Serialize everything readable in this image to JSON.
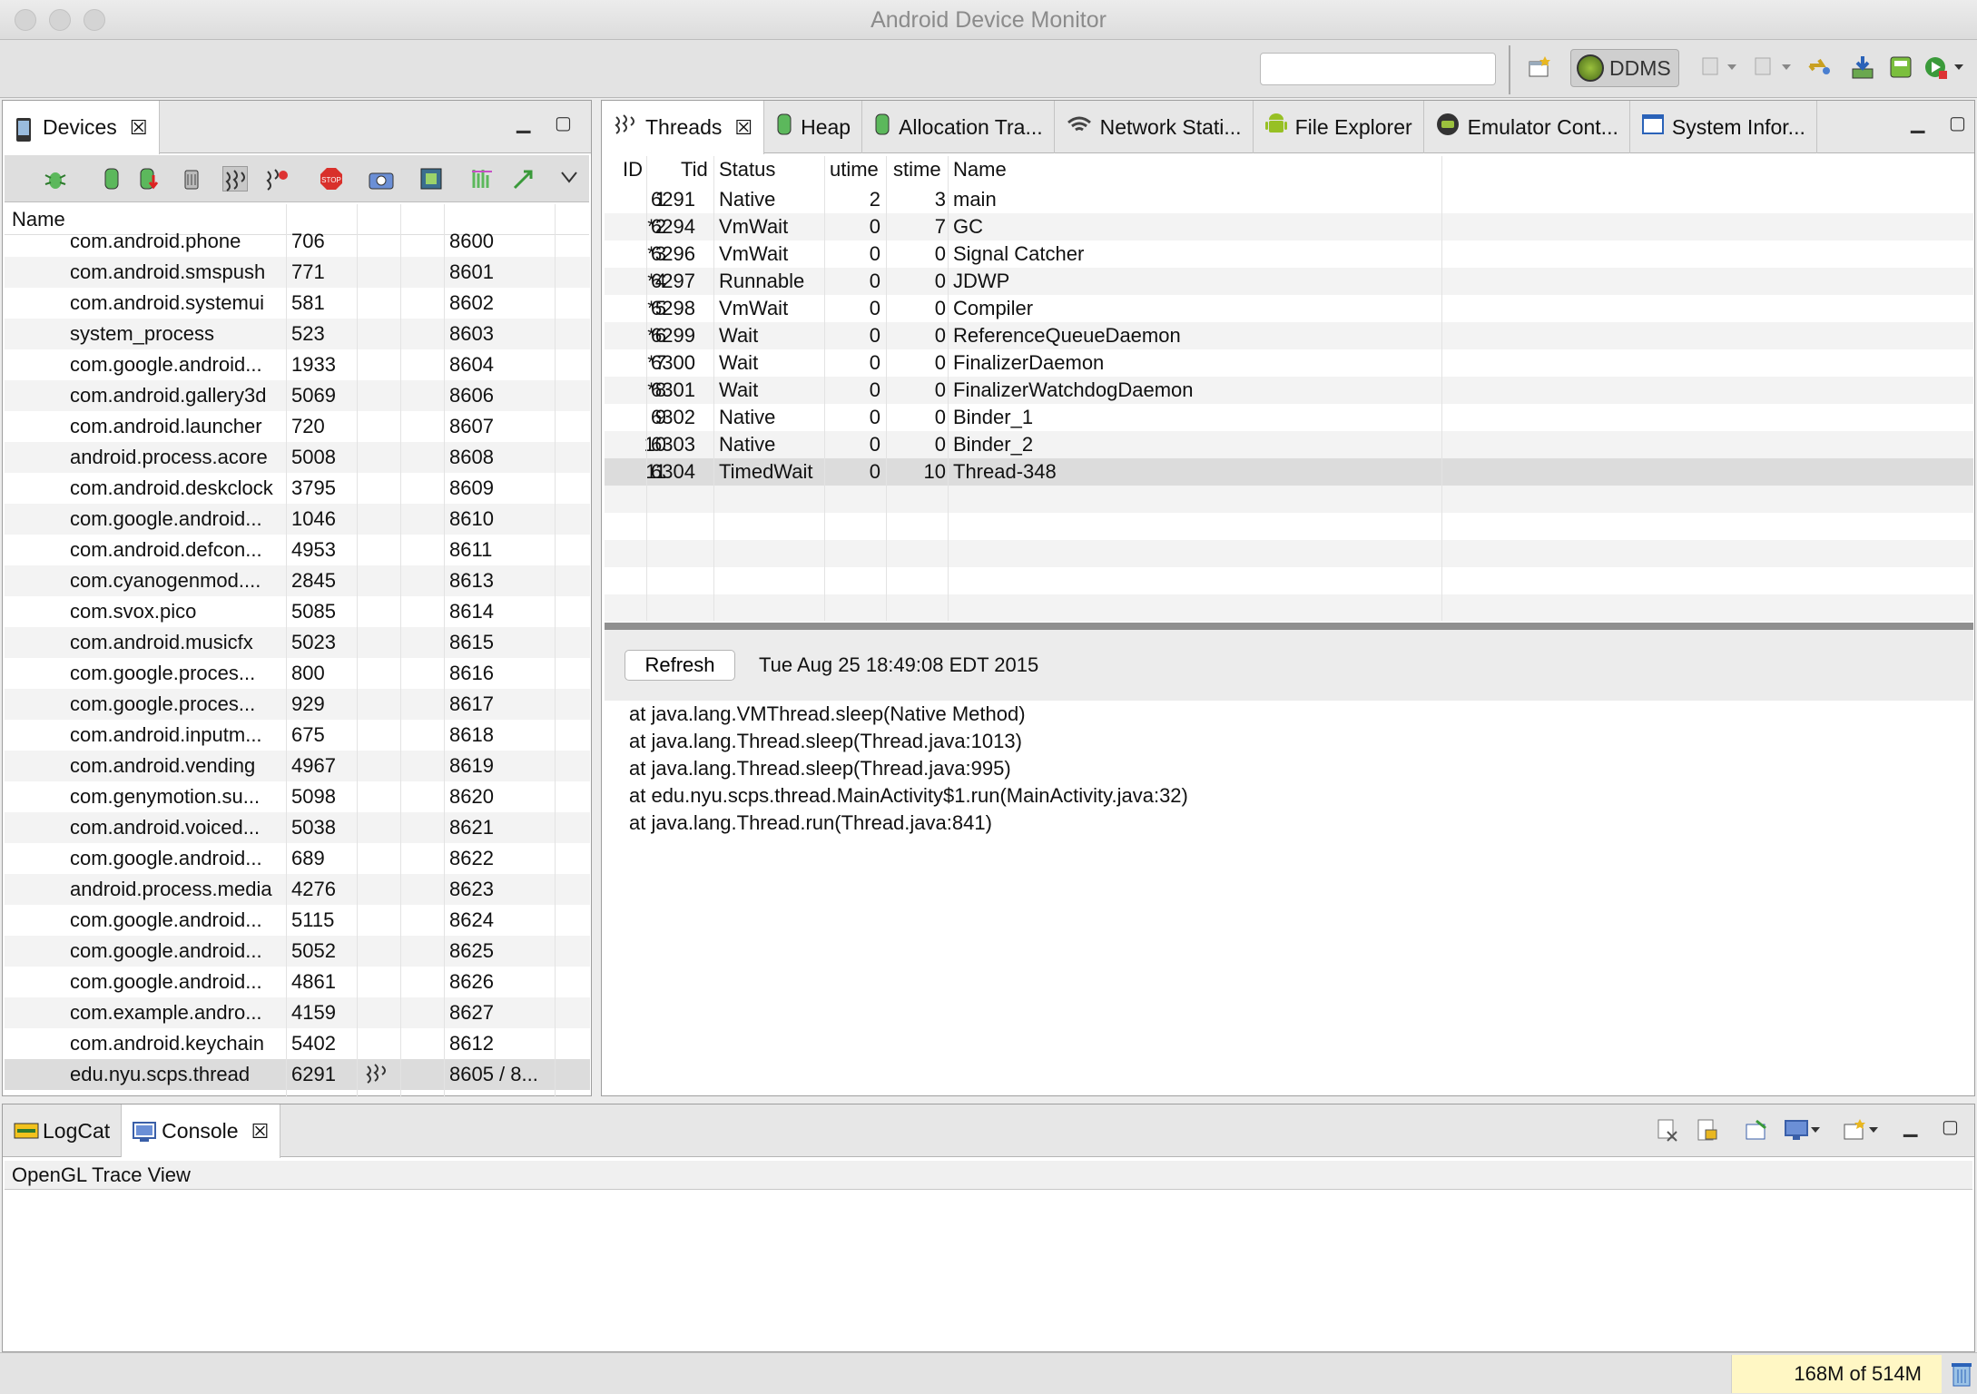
{
  "window": {
    "title": "Android Device Monitor"
  },
  "toolbar": {
    "perspective_label": "DDMS"
  },
  "devices": {
    "tab_label": "Devices",
    "column_name": "Name",
    "rows": [
      {
        "name": "com.android.phone",
        "pid": "706",
        "port": "8600",
        "selected": false
      },
      {
        "name": "com.android.smspush",
        "pid": "771",
        "port": "8601",
        "selected": false
      },
      {
        "name": "com.android.systemui",
        "pid": "581",
        "port": "8602",
        "selected": false
      },
      {
        "name": "system_process",
        "pid": "523",
        "port": "8603",
        "selected": false
      },
      {
        "name": "com.google.android...",
        "pid": "1933",
        "port": "8604",
        "selected": false
      },
      {
        "name": "com.android.gallery3d",
        "pid": "5069",
        "port": "8606",
        "selected": false
      },
      {
        "name": "com.android.launcher",
        "pid": "720",
        "port": "8607",
        "selected": false
      },
      {
        "name": "android.process.acore",
        "pid": "5008",
        "port": "8608",
        "selected": false
      },
      {
        "name": "com.android.deskclock",
        "pid": "3795",
        "port": "8609",
        "selected": false
      },
      {
        "name": "com.google.android...",
        "pid": "1046",
        "port": "8610",
        "selected": false
      },
      {
        "name": "com.android.defcon...",
        "pid": "4953",
        "port": "8611",
        "selected": false
      },
      {
        "name": "com.cyanogenmod....",
        "pid": "2845",
        "port": "8613",
        "selected": false
      },
      {
        "name": "com.svox.pico",
        "pid": "5085",
        "port": "8614",
        "selected": false
      },
      {
        "name": "com.android.musicfx",
        "pid": "5023",
        "port": "8615",
        "selected": false
      },
      {
        "name": "com.google.proces...",
        "pid": "800",
        "port": "8616",
        "selected": false
      },
      {
        "name": "com.google.proces...",
        "pid": "929",
        "port": "8617",
        "selected": false
      },
      {
        "name": "com.android.inputm...",
        "pid": "675",
        "port": "8618",
        "selected": false
      },
      {
        "name": "com.android.vending",
        "pid": "4967",
        "port": "8619",
        "selected": false
      },
      {
        "name": "com.genymotion.su...",
        "pid": "5098",
        "port": "8620",
        "selected": false
      },
      {
        "name": "com.android.voiced...",
        "pid": "5038",
        "port": "8621",
        "selected": false
      },
      {
        "name": "com.google.android...",
        "pid": "689",
        "port": "8622",
        "selected": false
      },
      {
        "name": "android.process.media",
        "pid": "4276",
        "port": "8623",
        "selected": false
      },
      {
        "name": "com.google.android...",
        "pid": "5115",
        "port": "8624",
        "selected": false
      },
      {
        "name": "com.google.android...",
        "pid": "5052",
        "port": "8625",
        "selected": false
      },
      {
        "name": "com.google.android...",
        "pid": "4861",
        "port": "8626",
        "selected": false
      },
      {
        "name": "com.example.andro...",
        "pid": "4159",
        "port": "8627",
        "selected": false
      },
      {
        "name": "com.android.keychain",
        "pid": "5402",
        "port": "8612",
        "selected": false
      },
      {
        "name": "edu.nyu.scps.thread",
        "pid": "6291",
        "port": "8605 / 8...",
        "selected": true
      }
    ]
  },
  "tabs": [
    {
      "label": "Threads",
      "icon": "threads-icon"
    },
    {
      "label": "Heap",
      "icon": "heap-icon"
    },
    {
      "label": "Allocation Tra...",
      "icon": "allocation-icon"
    },
    {
      "label": "Network Stati...",
      "icon": "wifi-icon"
    },
    {
      "label": "File Explorer",
      "icon": "android-icon"
    },
    {
      "label": "Emulator Cont...",
      "icon": "emulator-icon"
    },
    {
      "label": "System Infor...",
      "icon": "window-icon"
    }
  ],
  "threads": {
    "headers": {
      "id": "ID",
      "tid": "Tid",
      "status": "Status",
      "utime": "utime",
      "stime": "stime",
      "name": "Name"
    },
    "rows": [
      {
        "id": "1",
        "tid": "6291",
        "status": "Native",
        "utime": "2",
        "stime": "3",
        "name": "main",
        "selected": false
      },
      {
        "id": "*2",
        "tid": "6294",
        "status": "VmWait",
        "utime": "0",
        "stime": "7",
        "name": "GC",
        "selected": false
      },
      {
        "id": "*3",
        "tid": "6296",
        "status": "VmWait",
        "utime": "0",
        "stime": "0",
        "name": "Signal Catcher",
        "selected": false
      },
      {
        "id": "*4",
        "tid": "6297",
        "status": "Runnable",
        "utime": "0",
        "stime": "0",
        "name": "JDWP",
        "selected": false
      },
      {
        "id": "*5",
        "tid": "6298",
        "status": "VmWait",
        "utime": "0",
        "stime": "0",
        "name": "Compiler",
        "selected": false
      },
      {
        "id": "*6",
        "tid": "6299",
        "status": "Wait",
        "utime": "0",
        "stime": "0",
        "name": "ReferenceQueueDaemon",
        "selected": false
      },
      {
        "id": "*7",
        "tid": "6300",
        "status": "Wait",
        "utime": "0",
        "stime": "0",
        "name": "FinalizerDaemon",
        "selected": false
      },
      {
        "id": "*8",
        "tid": "6301",
        "status": "Wait",
        "utime": "0",
        "stime": "0",
        "name": "FinalizerWatchdogDaemon",
        "selected": false
      },
      {
        "id": "9",
        "tid": "6302",
        "status": "Native",
        "utime": "0",
        "stime": "0",
        "name": "Binder_1",
        "selected": false
      },
      {
        "id": "10",
        "tid": "6303",
        "status": "Native",
        "utime": "0",
        "stime": "0",
        "name": "Binder_2",
        "selected": false
      },
      {
        "id": "11",
        "tid": "6304",
        "status": "TimedWait",
        "utime": "0",
        "stime": "10",
        "name": "Thread-348",
        "selected": true
      }
    ],
    "refresh_label": "Refresh",
    "refresh_time": "Tue Aug 25 18:49:08 EDT 2015",
    "stack_trace": [
      "at java.lang.VMThread.sleep(Native Method)",
      "at java.lang.Thread.sleep(Thread.java:1013)",
      "at java.lang.Thread.sleep(Thread.java:995)",
      "at edu.nyu.scps.thread.MainActivity$1.run(MainActivity.java:32)",
      "at java.lang.Thread.run(Thread.java:841)"
    ]
  },
  "bottom": {
    "tabs": [
      {
        "label": "LogCat",
        "icon": "logcat-icon"
      },
      {
        "label": "Console",
        "icon": "console-icon"
      }
    ],
    "console_title": "OpenGL Trace View"
  },
  "status": {
    "heap": "168M of 514M"
  }
}
